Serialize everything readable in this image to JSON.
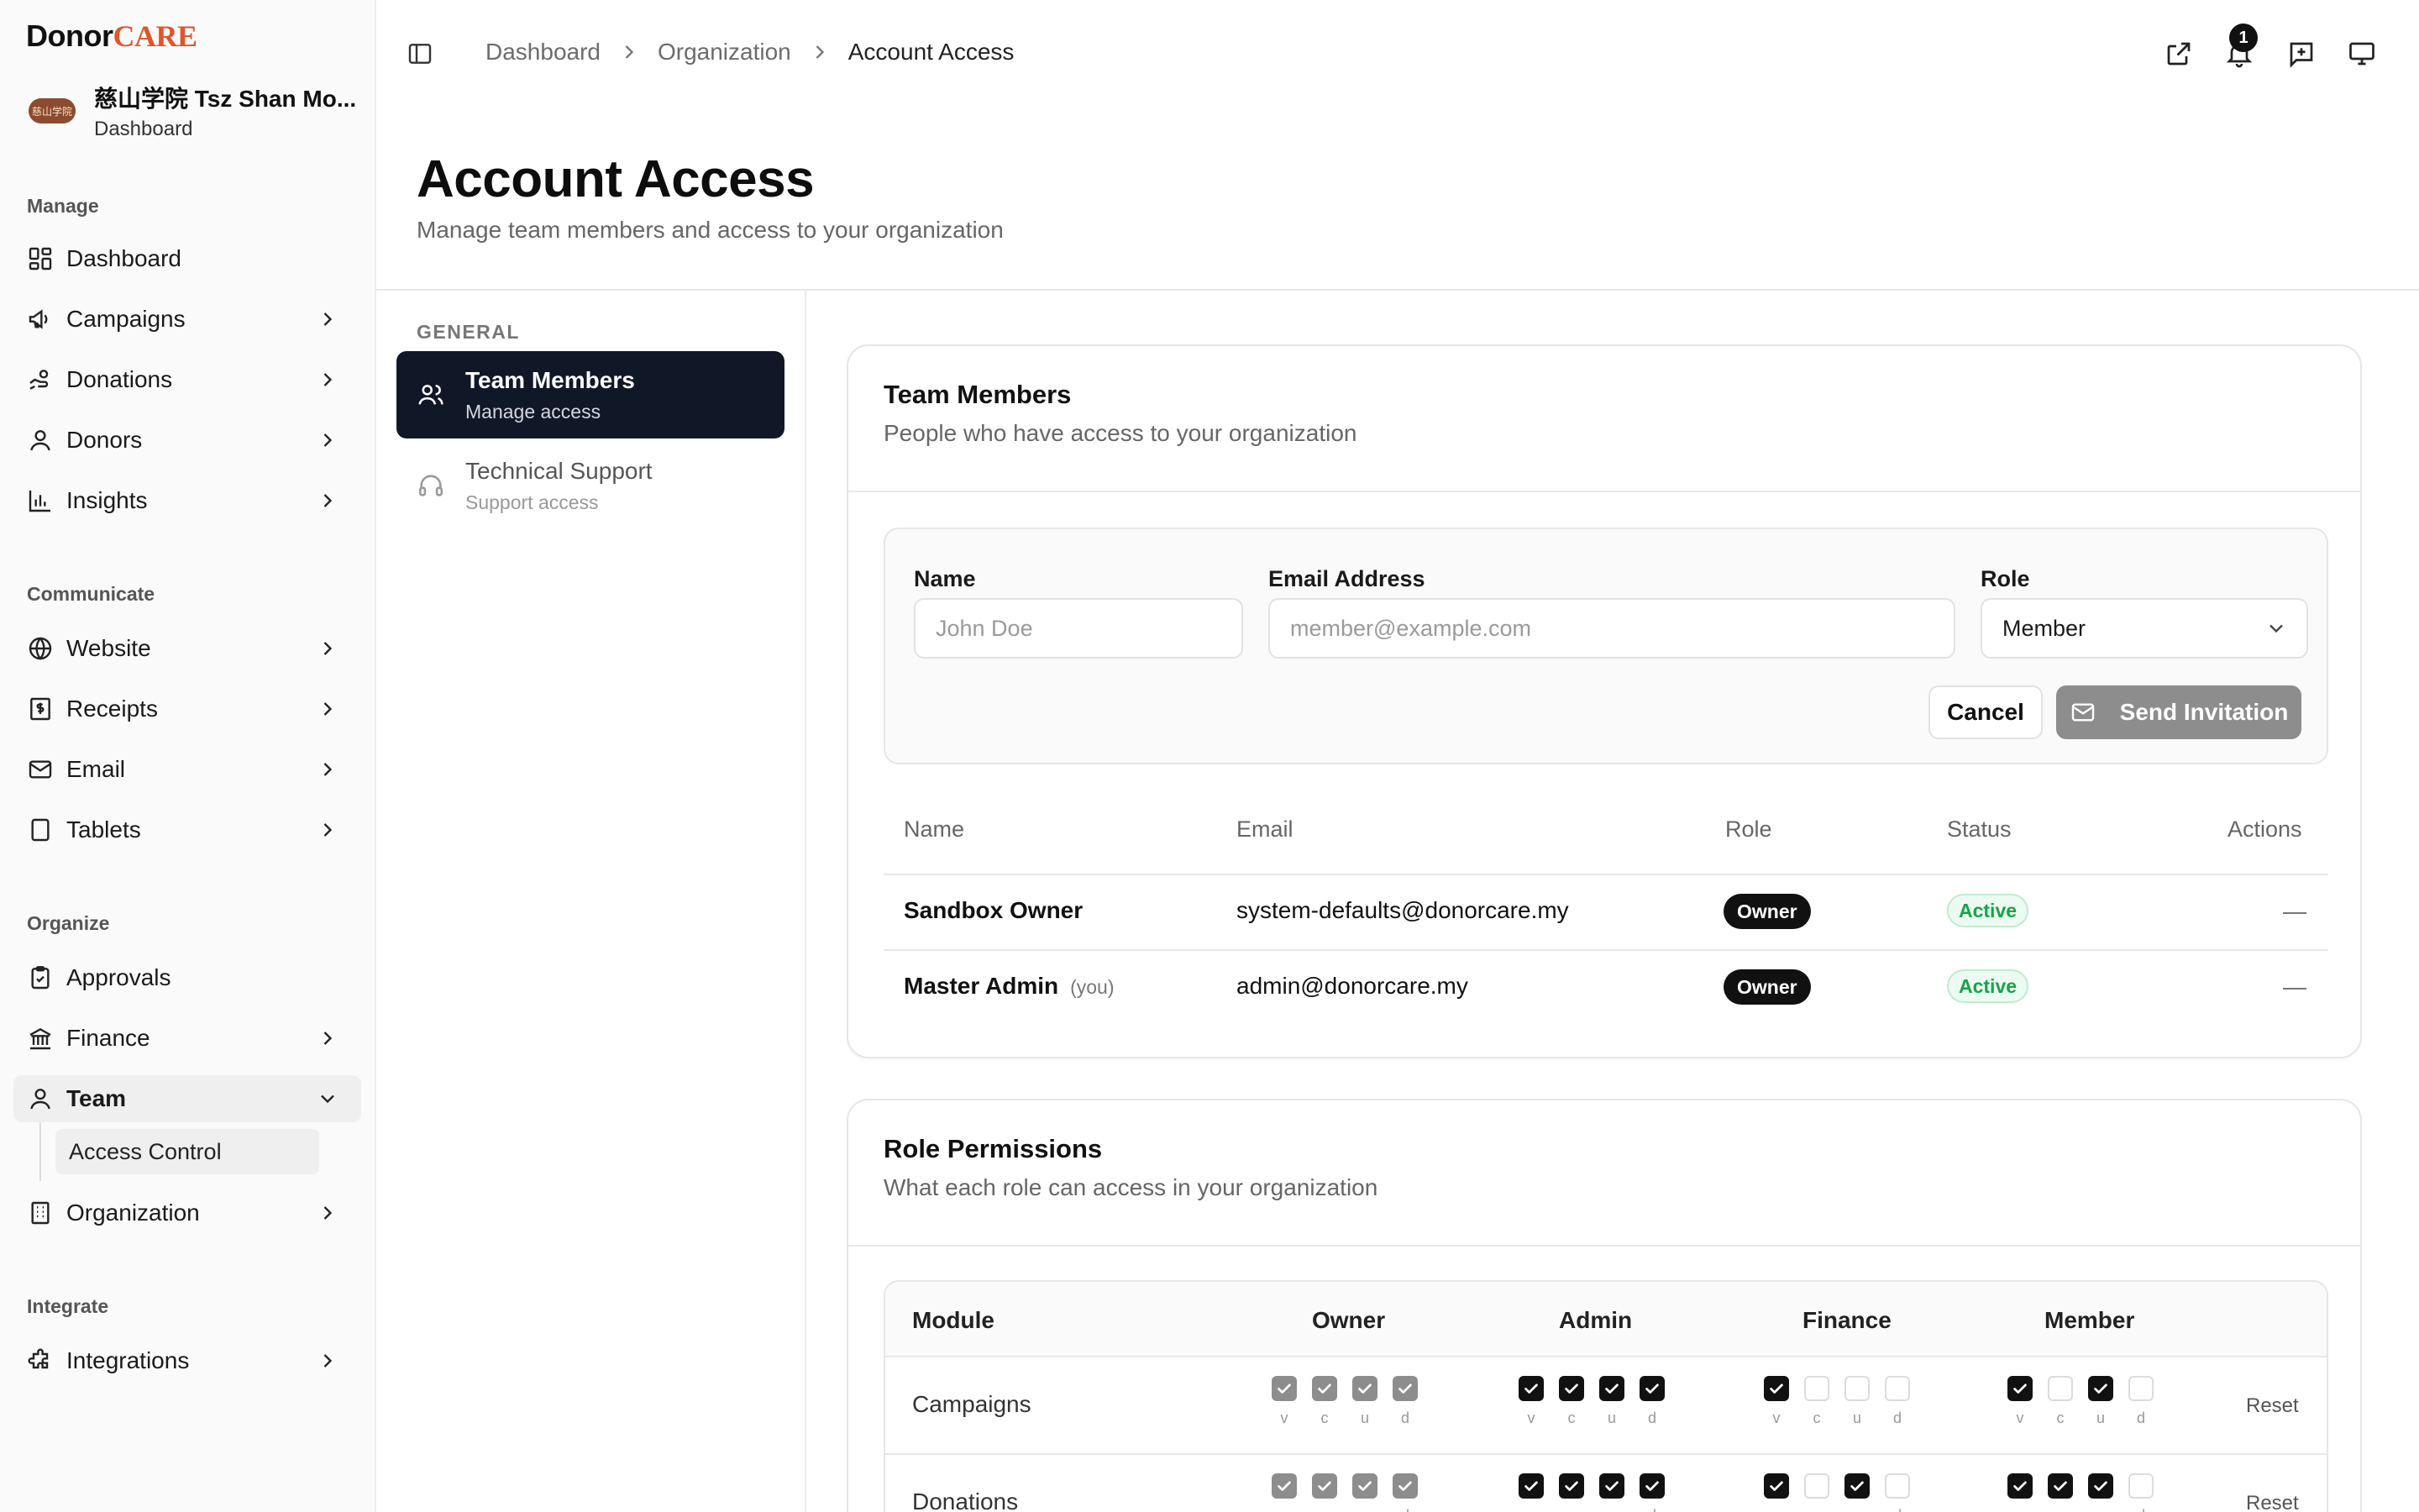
{
  "brand": {
    "part1": "Donor",
    "part2": "CARE"
  },
  "org": {
    "name": "慈山学院 Tsz Shan Mo...",
    "sub": "Dashboard",
    "avatar_text": "慈山学院"
  },
  "sidebar": {
    "sections": {
      "manage": "Manage",
      "communicate": "Communicate",
      "organize": "Organize",
      "integrate": "Integrate"
    },
    "items": [
      {
        "label": "Dashboard",
        "icon": "dashboard-icon"
      },
      {
        "label": "Campaigns",
        "icon": "megaphone-icon"
      },
      {
        "label": "Donations",
        "icon": "hand-coins-icon"
      },
      {
        "label": "Donors",
        "icon": "user-icon"
      },
      {
        "label": "Insights",
        "icon": "bar-chart-icon"
      },
      {
        "label": "Website",
        "icon": "globe-icon"
      },
      {
        "label": "Receipts",
        "icon": "receipt-icon"
      },
      {
        "label": "Email",
        "icon": "mail-icon"
      },
      {
        "label": "Tablets",
        "icon": "tablet-icon"
      },
      {
        "label": "Approvals",
        "icon": "clipboard-check-icon"
      },
      {
        "label": "Finance",
        "icon": "bank-icon"
      },
      {
        "label": "Team",
        "icon": "user-icon"
      },
      {
        "label": "Organization",
        "icon": "building-icon"
      },
      {
        "label": "Integrations",
        "icon": "puzzle-icon"
      }
    ],
    "team_sub": "Access Control"
  },
  "breadcrumb": {
    "b1": "Dashboard",
    "b2": "Organization",
    "b3": "Account Access"
  },
  "notifications": {
    "count": "1"
  },
  "page": {
    "title": "Account Access",
    "subtitle": "Manage team members and access to your organization"
  },
  "subnav": {
    "label": "GENERAL",
    "items": [
      {
        "title": "Team Members",
        "sub": "Manage access"
      },
      {
        "title": "Technical Support",
        "sub": "Support access"
      }
    ]
  },
  "team_card": {
    "title": "Team Members",
    "subtitle": "People who have access to your organization",
    "form": {
      "name_label": "Name",
      "name_placeholder": "John Doe",
      "email_label": "Email Address",
      "email_placeholder": "member@example.com",
      "role_label": "Role",
      "role_value": "Member",
      "cancel": "Cancel",
      "send": "Send Invitation"
    },
    "columns": {
      "name": "Name",
      "email": "Email",
      "role": "Role",
      "status": "Status",
      "actions": "Actions"
    },
    "rows": [
      {
        "name": "Sandbox Owner",
        "you": "",
        "email": "system-defaults@donorcare.my",
        "role": "Owner",
        "status": "Active"
      },
      {
        "name": "Master Admin",
        "you": "(you)",
        "email": "admin@donorcare.my",
        "role": "Owner",
        "status": "Active"
      }
    ]
  },
  "perm_card": {
    "title": "Role Permissions",
    "subtitle": "What each role can access in your organization",
    "columns": {
      "module": "Module",
      "owner": "Owner",
      "admin": "Admin",
      "finance": "Finance",
      "member": "Member"
    },
    "cb_labels": {
      "v": "v",
      "c": "c",
      "u": "u",
      "d": "d"
    },
    "reset": "Reset",
    "rows": [
      {
        "module": "Campaigns",
        "owner": [
          "dis",
          "dis",
          "dis",
          "dis"
        ],
        "admin": [
          "on",
          "on",
          "on",
          "on"
        ],
        "finance": [
          "on",
          "off",
          "off",
          "off"
        ],
        "member": [
          "on",
          "off",
          "on",
          "off"
        ]
      },
      {
        "module": "Donations",
        "owner": [
          "dis",
          "dis",
          "dis",
          "dis"
        ],
        "admin": [
          "on",
          "on",
          "on",
          "on"
        ],
        "finance": [
          "on",
          "off",
          "on",
          "off"
        ],
        "member": [
          "on",
          "on",
          "on",
          "off"
        ]
      }
    ]
  }
}
